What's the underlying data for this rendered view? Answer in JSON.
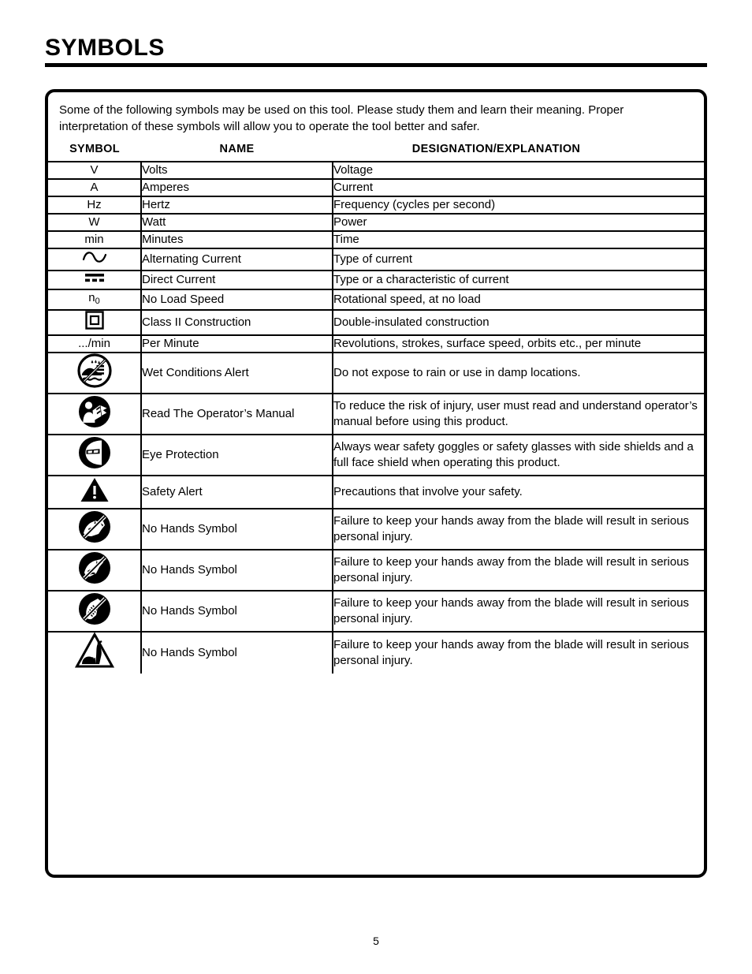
{
  "document": {
    "title": "SYMBOLS",
    "page_number": "5",
    "intro_text": "Some of the following symbols may be used on this tool. Please study them and learn their meaning. Proper interpretation of these symbols will allow you to operate the tool better and safer."
  },
  "table": {
    "headers": {
      "symbol": "SYMBOL",
      "name": "NAME",
      "designation": "DESIGNATION/EXPLANATION"
    },
    "rows": [
      {
        "symbol_kind": "text",
        "symbol_text": "V",
        "name": "Volts",
        "designation": "Voltage"
      },
      {
        "symbol_kind": "text",
        "symbol_text": "A",
        "name": "Amperes",
        "designation": "Current"
      },
      {
        "symbol_kind": "text",
        "symbol_text": "Hz",
        "name": " Hertz",
        "designation": "Frequency (cycles per second)"
      },
      {
        "symbol_kind": "text",
        "symbol_text": "W",
        "name": "Watt",
        "designation": "Power"
      },
      {
        "symbol_kind": "text",
        "symbol_text": "min",
        "name": "Minutes",
        "designation": "Time"
      },
      {
        "symbol_kind": "icon",
        "symbol_icon": "alternating-current-icon",
        "symbol_text": "",
        "name": "Alternating Current",
        "designation": "Type of current"
      },
      {
        "symbol_kind": "icon",
        "symbol_icon": "direct-current-icon",
        "symbol_text": "",
        "name": "Direct Current",
        "designation": "Type or a characteristic of current"
      },
      {
        "symbol_kind": "subscript",
        "symbol_text": "n",
        "symbol_sub": "0",
        "name": "No Load Speed",
        "designation": "Rotational speed, at no load"
      },
      {
        "symbol_kind": "icon",
        "symbol_icon": "class-two-construction-icon",
        "symbol_text": "",
        "name": "Class II Construction",
        "designation": "Double-insulated construction"
      },
      {
        "symbol_kind": "text",
        "symbol_text": ".../min",
        "name": "Per Minute",
        "designation": "Revolutions, strokes, surface speed, orbits etc., per minute"
      },
      {
        "symbol_kind": "icon",
        "symbol_icon": "wet-conditions-alert-icon",
        "symbol_text": "",
        "name": "Wet Conditions Alert",
        "designation": "Do not expose to rain or use in damp locations."
      },
      {
        "symbol_kind": "icon",
        "symbol_icon": "read-operators-manual-icon",
        "symbol_text": "",
        "name": "Read The Operator’s Manual",
        "designation": "To reduce the risk of injury, user must read and understand operator’s manual before using this product."
      },
      {
        "symbol_kind": "icon",
        "symbol_icon": "eye-protection-icon",
        "symbol_text": "",
        "name": "Eye Protection",
        "designation": "Always wear safety goggles or safety glasses with side shields and a full face shield when operating this product."
      },
      {
        "symbol_kind": "icon",
        "symbol_icon": "safety-alert-icon",
        "symbol_text": "",
        "name": "Safety Alert",
        "designation": "Precautions that involve your safety."
      },
      {
        "symbol_kind": "icon",
        "symbol_icon": "no-hands-circle-blade-icon",
        "symbol_text": "",
        "name": "No Hands Symbol",
        "designation": "Failure to keep your hands away from the blade will result in serious personal injury."
      },
      {
        "symbol_kind": "icon",
        "symbol_icon": "no-hands-circle-saw-icon",
        "symbol_text": "",
        "name": "No Hands Symbol",
        "designation": "Failure to keep your hands away from the blade will result in serious personal injury."
      },
      {
        "symbol_kind": "icon",
        "symbol_icon": "no-hands-circle-fingers-icon",
        "symbol_text": "",
        "name": "No Hands Symbol",
        "designation": "Failure to keep your hands away from the blade will result in serious personal injury."
      },
      {
        "symbol_kind": "icon",
        "symbol_icon": "no-hands-triangle-icon",
        "symbol_text": "",
        "name": "No Hands Symbol",
        "designation": "Failure to keep your hands away from the blade will result in serious personal injury."
      }
    ]
  },
  "colors": {
    "ink": "#000000",
    "paper": "#ffffff"
  }
}
